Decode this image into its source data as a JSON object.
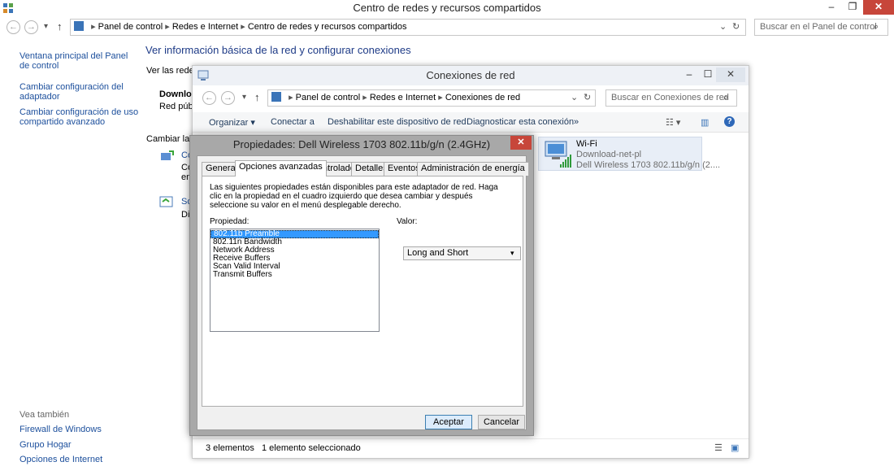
{
  "main": {
    "title": "Centro de redes y recursos compartidos",
    "caption": {
      "minimize": "–",
      "restore": "❐",
      "close": "✕"
    },
    "breadcrumb": [
      "Panel de control",
      "Redes e Internet",
      "Centro de redes y recursos compartidos"
    ],
    "search_placeholder": "Buscar en el Panel de control",
    "sidebar": {
      "links": [
        "Ventana principal del Panel de control",
        "Cambiar configuración del adaptador",
        "Cambiar configuración de uso compartido avanzado"
      ],
      "see_also_header": "Vea también",
      "see_also": [
        "Firewall de Windows",
        "Grupo Hogar",
        "Opciones de Internet"
      ]
    },
    "heading": "Ver información básica de la red y configurar conexiones",
    "partial": {
      "redes": "Ver las redes",
      "network_name": "Downlo",
      "network_type": "Red públi",
      "change": "Cambiar la c",
      "item1_a": "Co",
      "item1_b": "Co",
      "item1_c": "en",
      "item2_a": "So",
      "item2_b": "Di"
    }
  },
  "conexiones": {
    "title": "Conexiones de red",
    "caption": {
      "minimize": "–",
      "maximize": "☐",
      "close": "✕"
    },
    "breadcrumb": [
      "Panel de control",
      "Redes e Internet",
      "Conexiones de red"
    ],
    "search_placeholder": "Buscar en Conexiones de red",
    "toolbar": {
      "organize": "Organizar",
      "connect": "Conectar a",
      "disable": "Deshabilitar este dispositivo de red",
      "diagnose": "Diagnosticar esta conexión",
      "more": "»"
    },
    "adapter": {
      "name": "Wi-Fi",
      "network": "Download-net-pl",
      "device": "Dell Wireless 1703 802.11b/g/n (2...."
    },
    "status": {
      "count": "3 elementos",
      "selected": "1 elemento seleccionado"
    }
  },
  "dialog": {
    "title": "Propiedades: Dell Wireless 1703 802.11b/g/n (2.4GHz)",
    "close": "✕",
    "tabs": [
      "General",
      "Opciones avanzadas",
      "Controlador",
      "Detalles",
      "Eventos",
      "Administración de energía"
    ],
    "active_tab": "Opciones avanzadas",
    "description": "Las siguientes propiedades están disponibles para este adaptador de red. Haga clic en la propiedad en el cuadro izquierdo que desea cambiar y después seleccione su valor en el menú desplegable derecho.",
    "property_label": "Propiedad:",
    "value_label": "Valor:",
    "properties": [
      "802.11b Preamble",
      "802.11n Bandwidth",
      "Network Address",
      "Receive Buffers",
      "Scan Valid Interval",
      "Transmit Buffers"
    ],
    "selected_property": "802.11b Preamble",
    "value": "Long and Short",
    "ok": "Aceptar",
    "cancel": "Cancelar"
  },
  "colors": {
    "link": "#1c4f9c",
    "selection": "#3399ff",
    "close": "#c7463a"
  }
}
